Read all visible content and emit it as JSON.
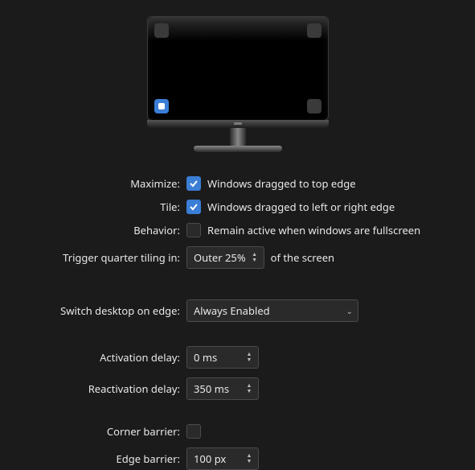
{
  "labels": {
    "maximize": "Maximize:",
    "tile": "Tile:",
    "behavior": "Behavior:",
    "trigger": "Trigger quarter tiling in:",
    "switch": "Switch desktop on edge:",
    "activation": "Activation delay:",
    "reactivation": "Reactivation delay:",
    "corner_barrier": "Corner barrier:",
    "edge_barrier": "Edge barrier:"
  },
  "values": {
    "maximize_text": "Windows dragged to top edge",
    "tile_text": "Windows dragged to left or right edge",
    "behavior_text": "Remain active when windows are fullscreen",
    "trigger_value": "Outer 25%",
    "trigger_suffix": "of the screen",
    "switch_value": "Always Enabled",
    "activation_value": "0 ms",
    "reactivation_value": "350 ms",
    "edge_barrier_value": "100 px"
  },
  "checked": {
    "maximize": true,
    "tile": true,
    "behavior": false,
    "corner_barrier": false
  }
}
